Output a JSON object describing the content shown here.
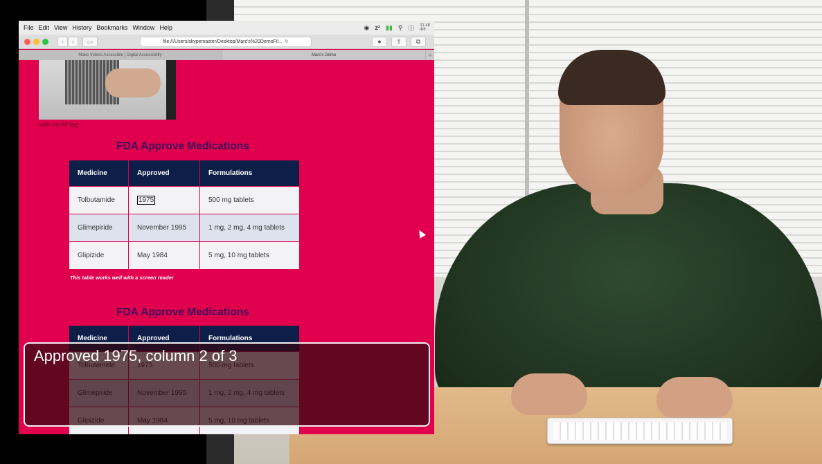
{
  "menubar": {
    "items": [
      "File",
      "Edit",
      "View",
      "History",
      "Bookmarks",
      "Window",
      "Help"
    ],
    "clock": "11:48\n4/6"
  },
  "browser": {
    "address": "file:///Users/skypemaster/Desktop/Marc's%20DemoFil...",
    "tabs": [
      "Make Videos Accessible | Digital Accessibility",
      "Marc's Demo"
    ]
  },
  "page": {
    "image_caption": "with no Alt tag",
    "heading": "FDA Approve Medications",
    "table_note": "This table works well with a screen reader",
    "table": {
      "headers": [
        "Medicine",
        "Approved",
        "Formulations"
      ],
      "rows": [
        [
          "Tolbutamide",
          "1975",
          "500 mg tablets"
        ],
        [
          "Glimepiride",
          "November 1995",
          "1 mg, 2 mg, 4 mg tablets"
        ],
        [
          "Glipizide",
          "May 1984",
          "5 mg, 10 mg tablets"
        ]
      ]
    },
    "heading2": "FDA Approve Medications"
  },
  "voiceover": {
    "caption": "Approved 1975, column 2 of 3"
  },
  "colors": {
    "page_bg": "#e0004d",
    "table_header": "#0d1e48",
    "heading": "#3d0b5a"
  }
}
